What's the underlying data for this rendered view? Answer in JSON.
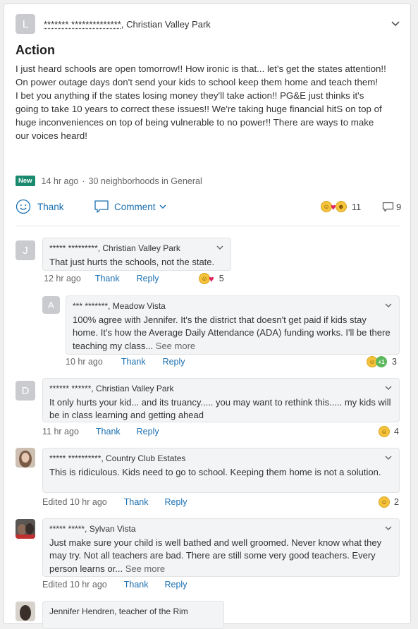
{
  "post": {
    "avatar_initial": "L",
    "author_masked": "******* **************",
    "author_location": ", Christian Valley Park",
    "title": "Action",
    "body": [
      "I just heard schools are open tomorrow!! How ironic is that... let's get the states attention!!",
      "On power outage days don't send your kids to school keep them home and teach them!",
      "I bet you anything if the states losing money they'll take action!!  PG&E just thinks it's going to take 10 years to correct these issues!!  We're taking huge financial hitS on top of huge inconveniences on top of being vulnerable to no power!! There are ways to make our voices heard!"
    ],
    "badge": "New",
    "time": "14 hr ago",
    "separator": "·",
    "audience": "30 neighborhoods in General",
    "thank_label": "Thank",
    "comment_label": "Comment",
    "reaction_count": "11",
    "comment_count": "9"
  },
  "comments": [
    {
      "avatar_initial": "J",
      "author": "***** *********, Christian Valley Park",
      "text": "That just hurts the schools, not the state.",
      "time": "12 hr ago",
      "thank": "Thank",
      "reply": "Reply",
      "reactions": "5"
    },
    {
      "avatar_initial": "A",
      "author": "*** *******, Meadow Vista",
      "text": "100% agree with Jennifer. It's the district that doesn't get paid if kids stay home. It's how the Average Daily Attendance (ADA) funding works. I'll be there teaching my class...",
      "see_more": "See more",
      "time": "10 hr ago",
      "thank": "Thank",
      "reply": "Reply",
      "plus_label": "+1",
      "reactions": "3"
    },
    {
      "avatar_initial": "D",
      "author": "****** ******, Christian Valley Park",
      "text": "It only hurts your kid... and its truancy..... you may want to rethink this..... my kids will be in class learning and getting ahead",
      "time": "11 hr ago",
      "thank": "Thank",
      "reply": "Reply",
      "reactions": "4"
    },
    {
      "author": "***** **********, Country Club Estates",
      "text": "This is ridiculous.  Kids need to go to school.  Keeping them home is not a solution.",
      "time": "Edited 10 hr ago",
      "thank": "Thank",
      "reply": "Reply",
      "reactions": "2"
    },
    {
      "author": "***** *****, Sylvan Vista",
      "text": "Just make sure your child is well bathed and well groomed. Never know what they may try. Not all teachers are bad. There are still some very good teachers. Every person learns or...",
      "see_more": "See more",
      "time": "Edited 10 hr ago",
      "thank": "Thank",
      "reply": "Reply"
    },
    {
      "author": "Jennifer Hendren, teacher of the Rim"
    }
  ],
  "colors": {
    "link": "#1a6fb0",
    "badge": "#1a8a6f",
    "heart": "#e0245e"
  }
}
